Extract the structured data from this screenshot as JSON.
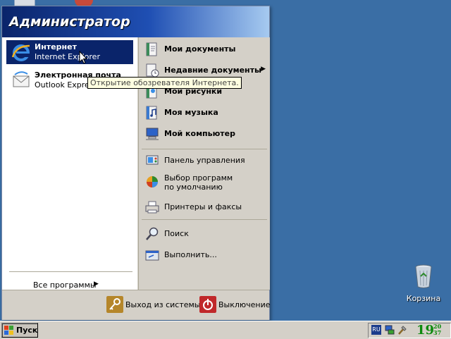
{
  "desktop": {
    "recycle_bin_label": "Корзина"
  },
  "start_menu": {
    "user_name": "Администратор",
    "pinned": [
      {
        "title": "Интернет",
        "subtitle": "Internet Explorer",
        "icon": "internet-explorer-icon",
        "selected": true
      },
      {
        "title": "Электронная почта",
        "subtitle": "Outlook Express",
        "icon": "outlook-express-icon",
        "selected": false
      }
    ],
    "all_programs_label": "Все программы",
    "places": [
      {
        "label": "Мои документы",
        "icon": "my-documents-icon"
      },
      {
        "label": "Недавние документы",
        "icon": "recent-documents-icon",
        "submenu": true
      },
      {
        "label": "Мои рисунки",
        "icon": "my-pictures-icon"
      },
      {
        "label": "Моя музыка",
        "icon": "my-music-icon"
      },
      {
        "label": "Мой компьютер",
        "icon": "my-computer-icon"
      }
    ],
    "system": [
      {
        "label": "Панель управления",
        "icon": "control-panel-icon"
      },
      {
        "label": "Выбор программ по умолчанию",
        "icon": "default-programs-icon"
      },
      {
        "label": "Принтеры и факсы",
        "icon": "printers-icon"
      }
    ],
    "tools": [
      {
        "label": "Поиск",
        "icon": "search-icon"
      },
      {
        "label": "Выполнить...",
        "icon": "run-icon"
      }
    ],
    "logoff_label": "Выход из системы",
    "shutdown_label": "Выключение",
    "tooltip": "Открытие обозревателя Интернета."
  },
  "taskbar": {
    "start_label": "Пуск",
    "language": "RU",
    "clock_hour": "19",
    "clock_minute_top": "20",
    "clock_minute_bottom": "37"
  },
  "colors": {
    "desktop": "#3a6ea5",
    "header_dark": "#0a246a",
    "selection": "#0a246a",
    "menu_face": "#d4d0c8",
    "shutdown_red": "#c0282a"
  }
}
